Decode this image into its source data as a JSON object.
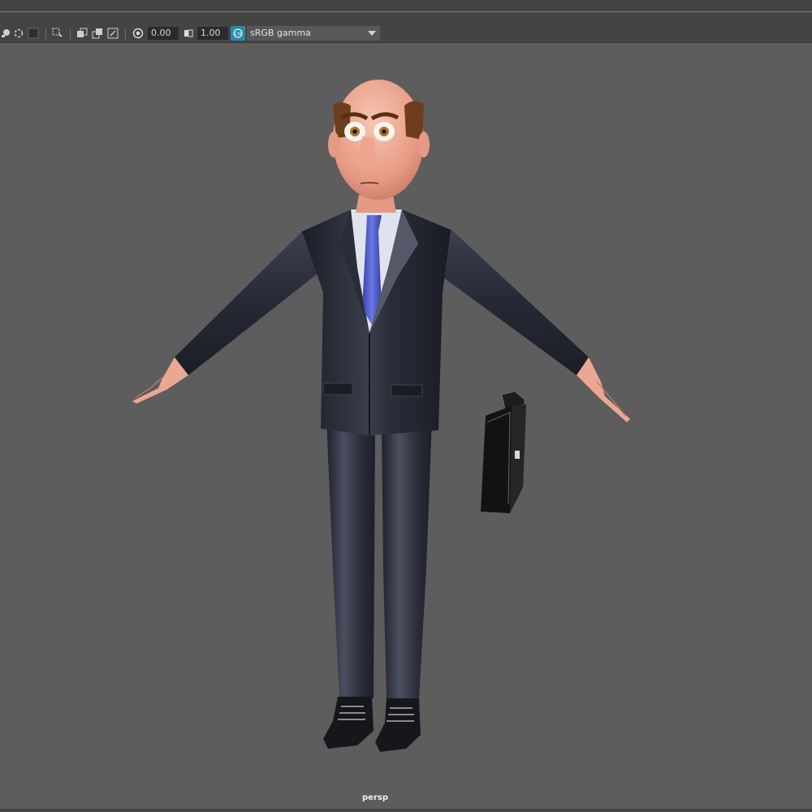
{
  "toolbar": {
    "exposure_value": "0.00",
    "gamma_value": "1.00",
    "color_space": "sRGB gamma",
    "icons": [
      "paint-icon",
      "isolate-icon",
      "shaded-icon",
      "select-icon",
      "copy-icon",
      "paste-icon",
      "resize-icon",
      "exposure-icon",
      "gamma-icon",
      "color-management-icon"
    ]
  },
  "viewport": {
    "camera_label": "persp",
    "scene": "businessman-character-t-pose-with-briefcase"
  },
  "colors": {
    "background": "#5d5d5d",
    "suit": "#23262f",
    "tie": "#4a57c9",
    "skin": "#e9a08a"
  }
}
